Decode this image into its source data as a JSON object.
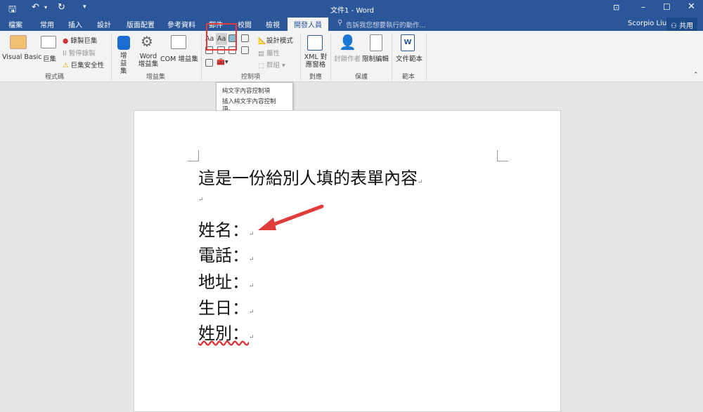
{
  "title": "文件1 - Word",
  "qat": {
    "save": "save-icon",
    "undo": "undo-icon",
    "redo": "redo-icon",
    "customize": "▾"
  },
  "tabs": [
    "檔案",
    "常用",
    "插入",
    "設計",
    "版面配置",
    "參考資料",
    "郵件",
    "校閱",
    "檢視",
    "開發人員"
  ],
  "tell_me": "告訴我您想要執行的動作...",
  "user": "Scorpio Liu",
  "share": "共用",
  "ribbon": {
    "code": {
      "visual_basic": "Visual Basic",
      "macros": "巨集",
      "record": "錄製巨集",
      "pause": "暫停錄製",
      "security": "巨集安全性",
      "group": "程式碼"
    },
    "addins": {
      "addins": "增益集",
      "word_addins": "Word 增益集",
      "com_addins": "COM 增益集",
      "group": "增益集"
    },
    "controls": {
      "design_mode": "設計模式",
      "properties": "屬性",
      "group_cmd": "群組",
      "group": "控制項"
    },
    "mapping": {
      "xml": "XML 對應窗格",
      "group": "對應"
    },
    "protect": {
      "block_authors": "封鎖作者",
      "restrict": "限制編輯",
      "group": "保護"
    },
    "templates": {
      "doc_template": "文件範本",
      "group": "範本"
    }
  },
  "tooltip": {
    "title": "純文字內容控制項",
    "desc": "插入純文字內容控制項。"
  },
  "document": {
    "lines": [
      "這是一份給別人填的表單內容",
      "",
      "姓名：",
      "電話：",
      "地址：",
      "生日：",
      "姓別："
    ],
    "para_mark": "↵"
  },
  "colors": {
    "accent": "#2b579a",
    "highlight": "#e03c3c"
  }
}
